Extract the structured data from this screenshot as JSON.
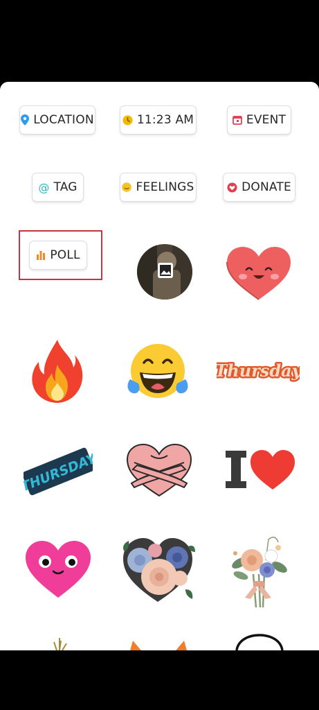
{
  "chips": {
    "location": "LOCATION",
    "time": "11:23 AM",
    "event": "EVENT",
    "tag": "TAG",
    "feelings": "FEELINGS",
    "donate": "DONATE",
    "poll": "POLL"
  },
  "stickers": {
    "thursday_orange": "Thursday",
    "thursday_blue": "THURSDAY"
  },
  "colors": {
    "location_icon": "#2b9cf0",
    "clock_icon": "#f5b800",
    "event_icon": "#e0404e",
    "tag_icon": "#28b6c6",
    "feelings_icon": "#f5c228",
    "donate_icon": "#e0404e",
    "poll_icon": "#f08a24",
    "highlight_border": "#c6343f"
  }
}
